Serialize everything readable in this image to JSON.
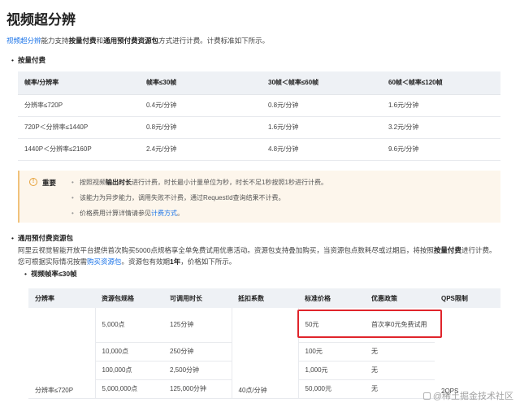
{
  "title": "视频超分辨",
  "intro": {
    "link": "视频超分辨",
    "t1": "能力支持",
    "b1": "按量付费",
    "t2": "和",
    "b2": "通用预付费资源包",
    "t3": "方式进行计费。计费标准如下所示。"
  },
  "payg": {
    "heading": "按量付费",
    "headers": [
      "帧率/分辨率",
      "帧率≤30帧",
      "30帧＜帧率≤60帧",
      "60帧＜帧率≤120帧"
    ],
    "rows": [
      [
        "分辨率≤720P",
        "0.4元/分钟",
        "0.8元/分钟",
        "1.6元/分钟"
      ],
      [
        "720P＜分辨率≤1440P",
        "0.8元/分钟",
        "1.6元/分钟",
        "3.2元/分钟"
      ],
      [
        "1440P＜分辨率≤2160P",
        "2.4元/分钟",
        "4.8元/分钟",
        "9.6元/分钟"
      ]
    ]
  },
  "notice": {
    "label": "重要",
    "items": [
      {
        "a": "按照视频",
        "b": "输出时长",
        "c": "进行计费，时长最小计量单位为秒，时长不足1秒按照1秒进行计费。"
      },
      {
        "a": "该能力为异步能力，调用失败不计费，通过RequestId查询结果不计费。"
      },
      {
        "a": "价格费用计算详情请参见",
        "link": "计费方式",
        "c": "。"
      }
    ]
  },
  "package": {
    "heading": "通用预付费资源包",
    "line1_a": "阿里云视觉智能开放平台提供首次购买5000点规格享全单免费试用优惠活动。资源包支持叠加购买，当资源包点数耗尽或过期后，将按照",
    "line1_b": "按量付费",
    "line1_c": "进行计费。",
    "line2_a": "您可根据实际情况按需",
    "line2_link": "购买资源包",
    "line2_b": "。资源包有效期",
    "line2_bold": "1年",
    "line2_c": "，价格如下所示。",
    "sub_heading": "视频帧率≤30帧",
    "headers": [
      "分辨率",
      "资源包规格",
      "可调用时长",
      "抵扣系数",
      "标准价格",
      "优惠政策",
      "QPS限制"
    ],
    "res_label": "分辨率≤720P",
    "coef": "40点/分钟",
    "qps": "2QPS",
    "rows": [
      [
        "5,000点",
        "125分钟",
        "50元",
        "首次享0元免费试用"
      ],
      [
        "10,000点",
        "250分钟",
        "100元",
        "无"
      ],
      [
        "100,000点",
        "2,500分钟",
        "1,000元",
        "无"
      ],
      [
        "5,000,000点",
        "125,000分钟",
        "50,000元",
        "无"
      ]
    ]
  },
  "watermark": "@稀土掘金技术社区"
}
